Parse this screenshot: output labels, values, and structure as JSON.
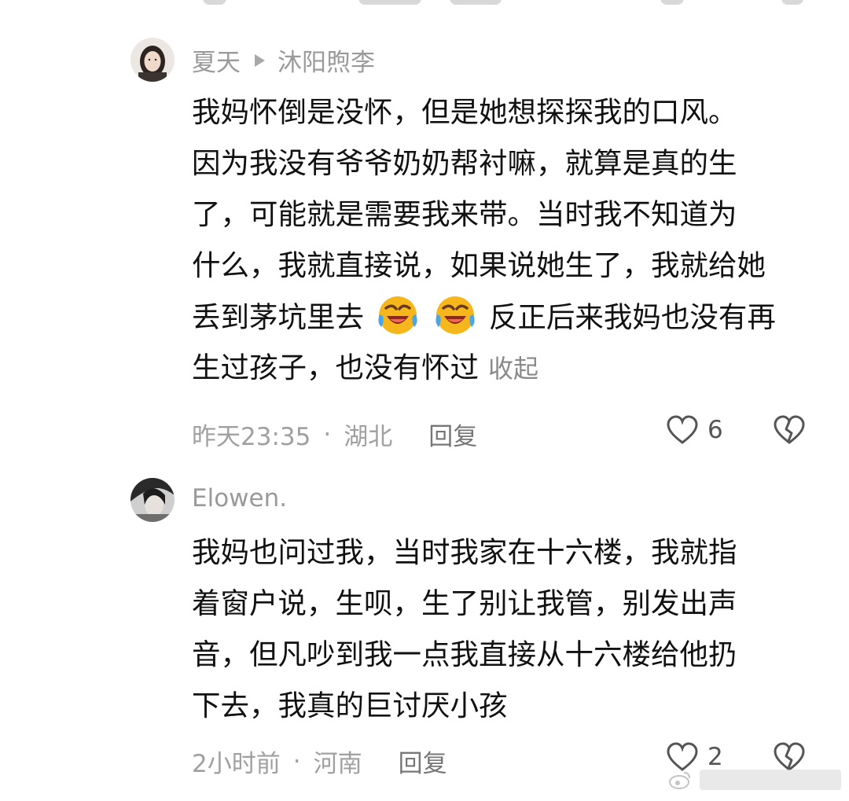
{
  "comments": [
    {
      "author": "夏天",
      "reply_to": "沐阳煦李",
      "lines": [
        "我妈怀倒是没怀，但是她想探探我的口风。",
        "因为我没有爷爷奶奶帮衬嘛，就算是真的生",
        "了，可能就是需要我来带。当时我不知道为",
        "什么，我就直接说，如果说她生了，我就给她",
        "丢到茅坑里去",
        "反正后来我妈也没有再",
        "生过孩子，也没有怀过"
      ],
      "emoji": "laughing-crying-emoji",
      "collapse_label": "收起",
      "time": "昨天23:35",
      "location": "湖北",
      "separator": "·",
      "reply_label": "回复",
      "likes": "6"
    },
    {
      "author": "Elowen.",
      "lines": [
        "我妈也问过我，当时我家在十六楼，我就指",
        "着窗户说，生呗，生了别让我管，别发出声",
        "音，但凡吵到我一点我直接从十六楼给他扔",
        "下去，我真的巨讨厌小孩"
      ],
      "time": "2小时前",
      "location": "河南",
      "separator": "·",
      "reply_label": "回复",
      "likes": "2"
    }
  ],
  "colors": {
    "text": "#111111",
    "meta": "#a0a0a0",
    "icon": "#555555"
  }
}
